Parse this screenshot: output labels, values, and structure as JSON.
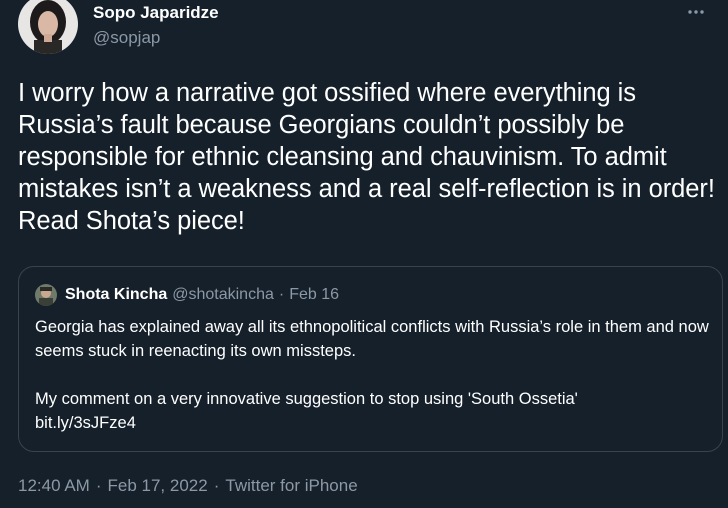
{
  "author": {
    "display_name": "Sopo Japaridze",
    "handle": "@sopjap"
  },
  "tweet": {
    "text": "I worry how a narrative got ossified where everything is Russia’s fault because Georgians couldn’t possibly be responsible for ethnic cleansing and chauvinism. To admit mistakes isn’t a weakness and a real self-reflection is in order! Read Shota’s piece!"
  },
  "quoted_tweet": {
    "display_name": "Shota Kincha",
    "handle": "@shotakincha",
    "separator": "·",
    "date": "Feb 16",
    "paragraph1": "Georgia has explained away all its ethnopolitical conflicts with Russia’s role in them and now seems stuck in reenacting its own missteps.",
    "paragraph2": "My comment on a very innovative suggestion to stop using 'South Ossetia'",
    "link": "bit.ly/3sJFze4"
  },
  "meta": {
    "time": "12:40 AM",
    "separator": "·",
    "date": "Feb 17, 2022",
    "source": "Twitter for iPhone"
  },
  "colors": {
    "background": "#15202b",
    "secondary_text": "#8b98a5",
    "border": "#38444d"
  },
  "icons": {
    "more": "more-horizontal-icon"
  }
}
